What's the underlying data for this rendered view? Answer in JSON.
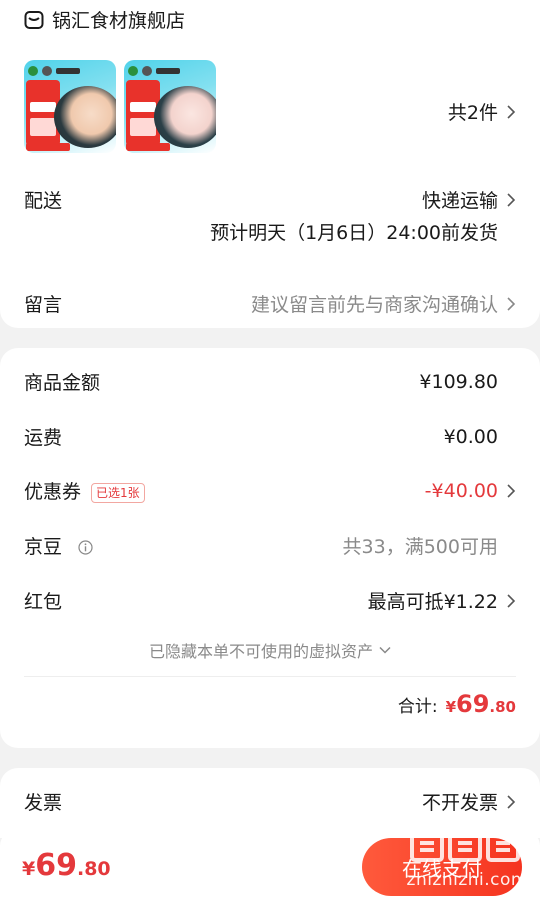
{
  "shop": {
    "name": "锅汇食材旗舰店"
  },
  "products": {
    "count_label": "共2件",
    "items": [
      {
        "name": "product-thumb-1"
      },
      {
        "name": "product-thumb-2"
      }
    ]
  },
  "delivery": {
    "label": "配送",
    "method": "快递运输",
    "estimate": "预计明天（1月6日）24:00前发货"
  },
  "message": {
    "label": "留言",
    "placeholder": "建议留言前先与商家沟通确认"
  },
  "pricing": {
    "goods_label": "商品金额",
    "goods_value": "¥109.80",
    "shipping_label": "运费",
    "shipping_value": "¥0.00",
    "coupon_label": "优惠券",
    "coupon_tag": "已选1张",
    "coupon_value": "-¥40.00",
    "jingdou_label": "京豆",
    "jingdou_value": "共33，满500可用",
    "redpacket_label": "红包",
    "redpacket_value": "最高可抵¥1.22",
    "hidden_note": "已隐藏本单不可使用的虚拟资产",
    "total_label": "合计:",
    "total_currency": "¥",
    "total_int": "69",
    "total_dec": ".80"
  },
  "invoice": {
    "label": "发票",
    "value": "不开发票"
  },
  "bottom": {
    "currency": "¥",
    "price_int": "69",
    "price_dec": ".80",
    "pay_label": "在线支付"
  },
  "watermark": {
    "text": "zhizhizhi.com",
    "logo_label": "值"
  },
  "colors": {
    "accent": "#e4393c",
    "pay_button": "#f5331f",
    "background": "#f2f2f2"
  }
}
